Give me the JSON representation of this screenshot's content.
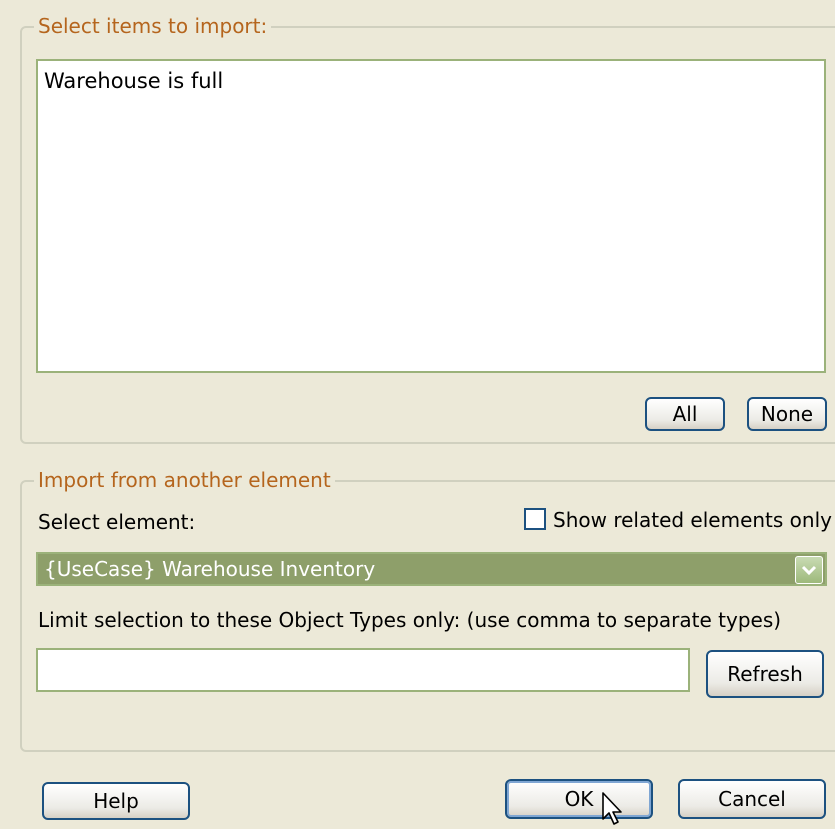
{
  "import_group": {
    "legend": "Select items to import:",
    "items": [
      "Warehouse is full"
    ],
    "all_button": "All",
    "none_button": "None"
  },
  "element_group": {
    "legend": "Import from another element",
    "select_label": "Select element:",
    "show_related_label": "Show related elements only",
    "show_related_checked": false,
    "selected_element": "{UseCase} Warehouse Inventory",
    "limit_label": "Limit selection to these Object Types only: (use comma to separate types)",
    "limit_value": "",
    "refresh_button": "Refresh"
  },
  "footer": {
    "help_button": "Help",
    "ok_button": "OK",
    "cancel_button": "Cancel"
  },
  "colors": {
    "dialog_bg": "#ece9d8",
    "legend_text": "#b5651d",
    "selection_bg": "#8e9f6a",
    "control_border": "#9bb27a"
  }
}
